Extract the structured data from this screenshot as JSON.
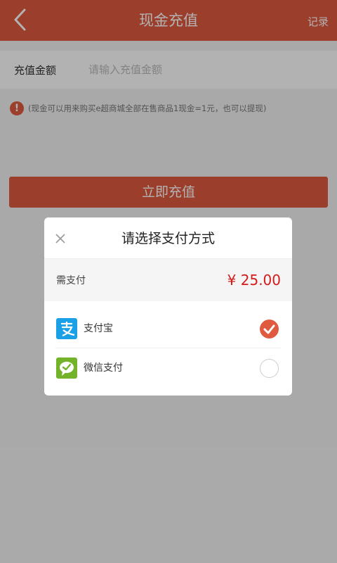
{
  "header": {
    "title": "现金充值",
    "record_label": "记录"
  },
  "amount": {
    "label": "充值金额",
    "placeholder": "请输入充值金额"
  },
  "notice": {
    "icon_text": "!",
    "text": "(现金可以用来购买e超商城全部在售商品1现金=1元，也可以提现)"
  },
  "submit": {
    "label": "立即充值"
  },
  "modal": {
    "title": "请选择支付方式",
    "pay_label": "需支付",
    "pay_amount": "¥ 25.00",
    "methods": [
      {
        "name": "支付宝",
        "icon": "alipay-icon",
        "selected": true
      },
      {
        "name": "微信支付",
        "icon": "wechat-icon",
        "selected": false
      }
    ]
  },
  "colors": {
    "brand": "#e05a3f",
    "price": "#d51a1a",
    "alipay": "#1aa0e6",
    "wechat": "#72b32a"
  }
}
